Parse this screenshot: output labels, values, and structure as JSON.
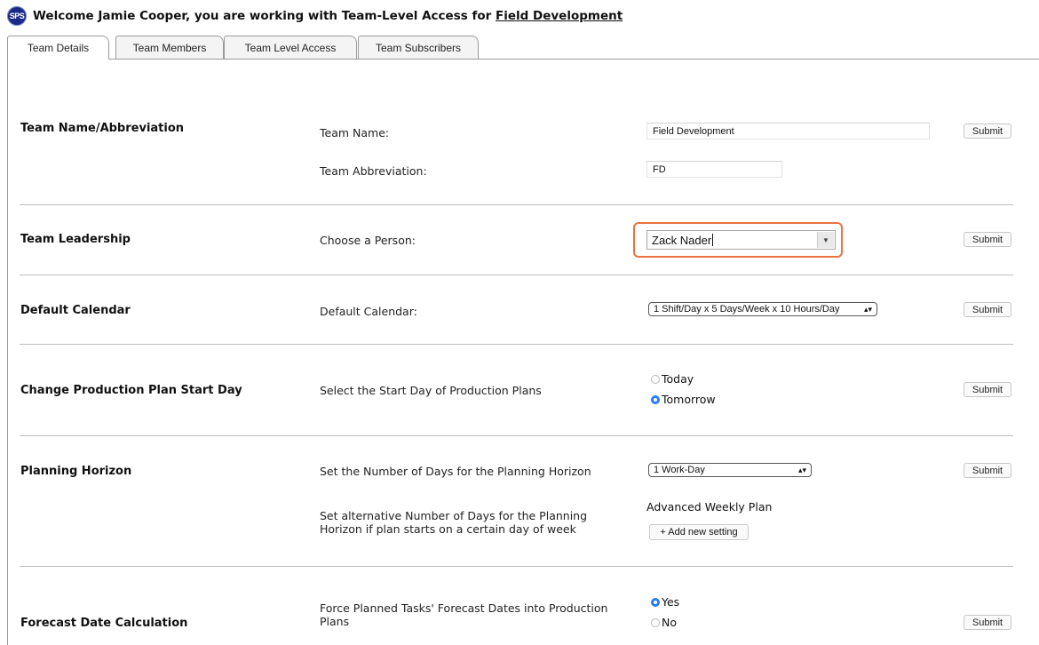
{
  "header": {
    "logo_text": "SPS",
    "welcome_prefix": "Welcome Jamie Cooper, you are working with Team-Level Access for ",
    "team_link": "Field Development"
  },
  "tabs": [
    {
      "label": "Team Details",
      "active": true
    },
    {
      "label": "Team Members",
      "active": false
    },
    {
      "label": "Team Level Access",
      "active": false
    },
    {
      "label": "Team Subscribers",
      "active": false
    }
  ],
  "sections": {
    "team_name": {
      "title": "Team Name/Abbreviation",
      "name_label": "Team Name:",
      "name_value": "Field Development",
      "abbr_label": "Team Abbreviation:",
      "abbr_value": "FD",
      "submit": "Submit"
    },
    "leadership": {
      "title": "Team Leadership",
      "label": "Choose a Person:",
      "value": "Zack Nader",
      "submit": "Submit"
    },
    "calendar": {
      "title": "Default Calendar",
      "label": "Default Calendar:",
      "value": "1 Shift/Day x 5 Days/Week x 10 Hours/Day",
      "submit": "Submit"
    },
    "start_day": {
      "title": "Change Production Plan Start Day",
      "label": "Select the Start Day of Production Plans",
      "options": [
        {
          "label": "Today",
          "checked": false
        },
        {
          "label": "Tomorrow",
          "checked": true
        }
      ],
      "submit": "Submit"
    },
    "horizon": {
      "title": "Planning Horizon",
      "label": "Set the Number of Days for the Planning Horizon",
      "value": "1 Work-Day",
      "alt_label_1": "Set alternative Number of Days for the Planning",
      "alt_label_2": "Horizon if plan starts on a certain day of week",
      "advanced_label": "Advanced Weekly Plan",
      "add_setting": "+ Add new setting",
      "submit": "Submit"
    },
    "forecast": {
      "title": "Forecast Date Calculation",
      "label_1": "Force Planned Tasks' Forecast Dates into Production",
      "label_2": "Plans",
      "options": [
        {
          "label": "Yes",
          "checked": true
        },
        {
          "label": "No",
          "checked": false
        }
      ],
      "submit": "Submit"
    }
  },
  "colors": {
    "logo_bg": "#1a2a86",
    "radio_checked": "#2a7cf6",
    "highlight": "#e8733f"
  }
}
